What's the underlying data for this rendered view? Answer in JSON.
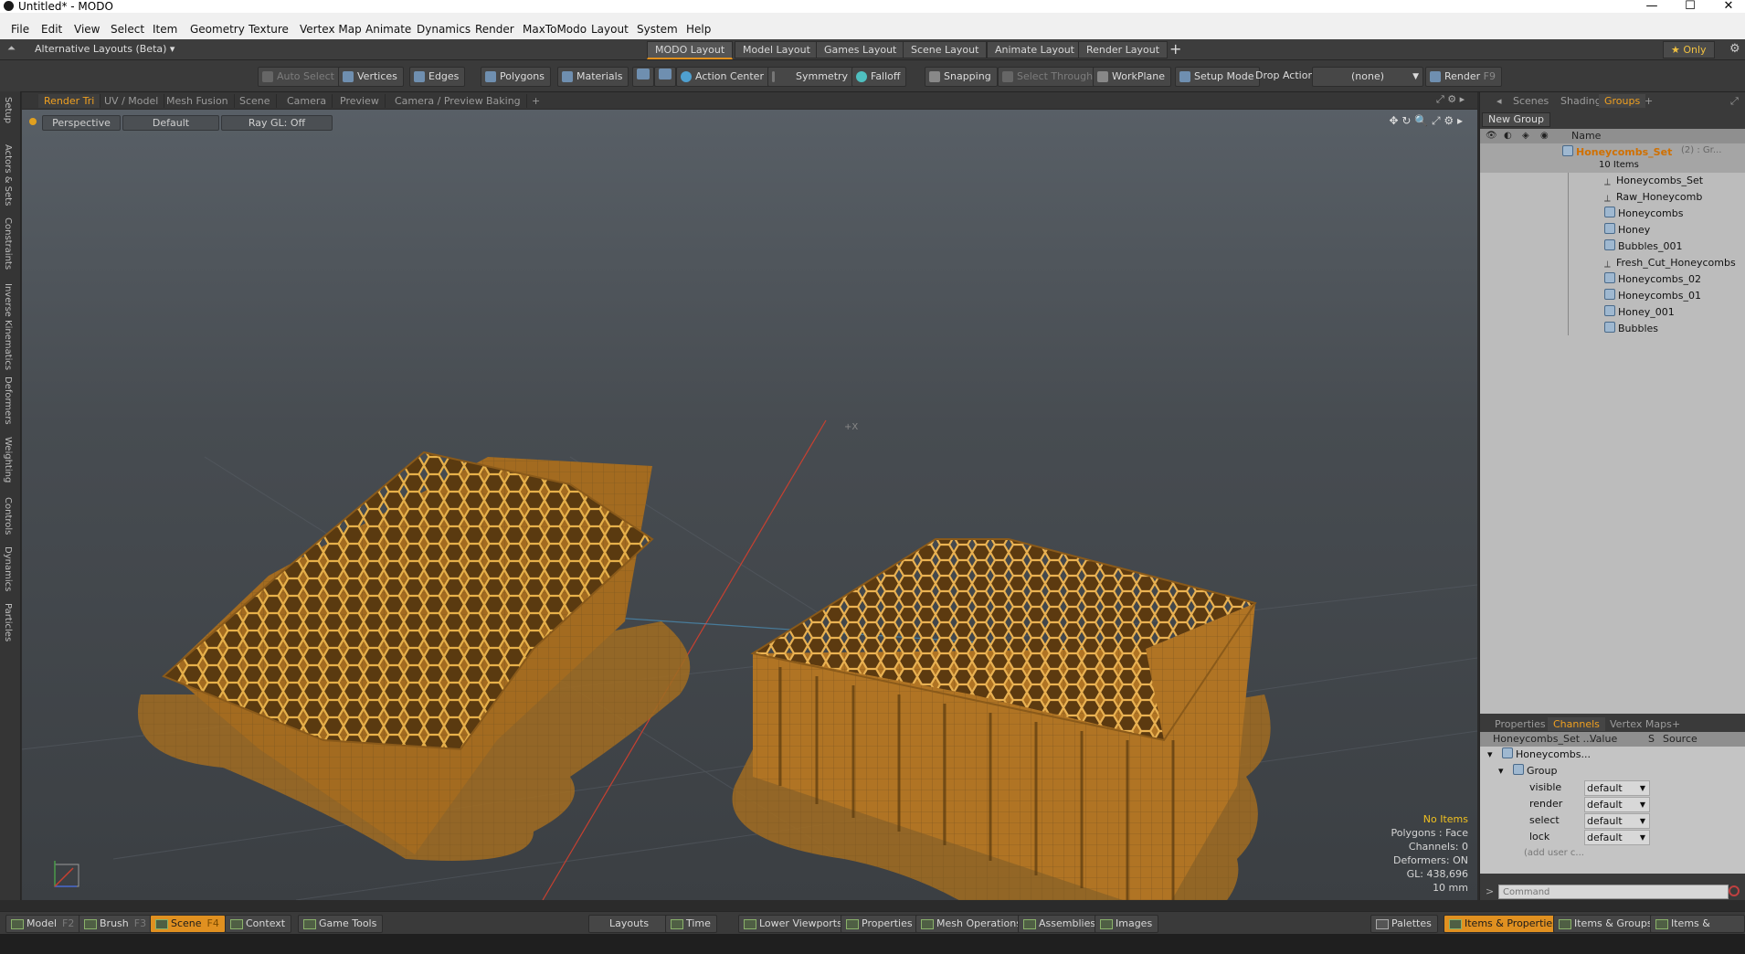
{
  "window": {
    "title": "Untitled* - MODO",
    "controls": [
      "—",
      "☐",
      "✕"
    ]
  },
  "menu": [
    "File",
    "Edit",
    "View",
    "Select",
    "Item",
    "Geometry",
    "Texture",
    "Vertex Map",
    "Animate",
    "Dynamics",
    "Render",
    "MaxToModo",
    "Layout",
    "System",
    "Help"
  ],
  "layout_bar": {
    "alt_layouts": "Alternative Layouts (Beta) ▾",
    "tabs": [
      "MODO Layout",
      "Model Layout",
      "Games Layout",
      "Scene Layout",
      "Animate Layout",
      "Render Layout"
    ],
    "active_tab": "MODO Layout",
    "add": "+",
    "only": "★  Only"
  },
  "toolbar": {
    "items": [
      "Auto Select",
      "Vertices",
      "Edges",
      "Polygons",
      "Materials",
      "Action Center",
      "Symmetry",
      "Falloff",
      "Snapping",
      "Select Through",
      "WorkPlane",
      "Setup Mode"
    ],
    "drop_action_label": "Drop Action",
    "drop_action_value": "(none)",
    "render": "Render",
    "render_key": "F9"
  },
  "left_tabs": [
    "Setup",
    "Actors & Sets",
    "Constraints",
    "Inverse Kinematics",
    "Deformers",
    "Weighting",
    "Controls",
    "Dynamics",
    "Particles"
  ],
  "viewport_tabs": [
    "Render Tri",
    "UV / Model",
    "Mesh Fusion",
    "Scene",
    "Camera",
    "Preview",
    "Camera / Preview",
    "Baking",
    "+"
  ],
  "viewport": {
    "view": "Perspective",
    "shading": "Default",
    "raygl": "Ray GL: Off",
    "info": {
      "items": "No Items",
      "polygons": "Polygons : Face",
      "channels": "Channels: 0",
      "deformers": "Deformers: ON",
      "gl": "GL: 438,696",
      "scale": "10 mm"
    }
  },
  "groups_panel": {
    "tabs": [
      "Scenes",
      "Shading",
      "Groups",
      "+"
    ],
    "active_tab": "Groups",
    "new_group": "New Group",
    "name_header": "Name",
    "root": {
      "name": "Honeycombs_Set",
      "suffix": "(2) : Gr...",
      "count": "10 Items"
    },
    "items": [
      {
        "name": "Honeycombs_Set",
        "type": "locator"
      },
      {
        "name": "Raw_Honeycomb",
        "type": "locator"
      },
      {
        "name": "Honeycombs",
        "type": "mesh"
      },
      {
        "name": "Honey",
        "type": "mesh"
      },
      {
        "name": "Bubbles_001",
        "type": "mesh"
      },
      {
        "name": "Fresh_Cut_Honeycombs",
        "type": "locator"
      },
      {
        "name": "Honeycombs_02",
        "type": "mesh"
      },
      {
        "name": "Honeycombs_01",
        "type": "mesh"
      },
      {
        "name": "Honey_001",
        "type": "mesh"
      },
      {
        "name": "Bubbles",
        "type": "mesh"
      }
    ]
  },
  "channels_panel": {
    "tabs": [
      "Properties",
      "Channels",
      "Vertex Maps",
      "+"
    ],
    "active_tab": "Channels",
    "headers": [
      "Honeycombs_Set ...",
      "Value",
      "S",
      "Source"
    ],
    "root": "Honeycombs...",
    "group": "Group",
    "rows": [
      {
        "name": "visible",
        "value": "default"
      },
      {
        "name": "render",
        "value": "default"
      },
      {
        "name": "select",
        "value": "default"
      },
      {
        "name": "lock",
        "value": "default"
      }
    ],
    "add_user": "(add user c...",
    "command_placeholder": "Command"
  },
  "bottom_bar": {
    "left": [
      {
        "label": "Model",
        "key": "F2"
      },
      {
        "label": "Brush",
        "key": "F3"
      },
      {
        "label": "Scene",
        "key": "F4",
        "active": true
      },
      {
        "label": "Context",
        "key": ""
      },
      {
        "label": "Game Tools",
        "key": ""
      }
    ],
    "center": [
      "Layouts",
      "Time",
      "Lower Viewports",
      "Properties",
      "Mesh Operations",
      "Assemblies",
      "Images"
    ],
    "right": [
      "Palettes",
      "Items & Properties",
      "Items & Groups",
      "Items & Shading"
    ],
    "right_active": "Items & Properties"
  },
  "colors": {
    "accent": "#e09020",
    "panel": "#3a3a3a",
    "list_bg": "#bcbcbc",
    "honey": "#c98a2a"
  }
}
